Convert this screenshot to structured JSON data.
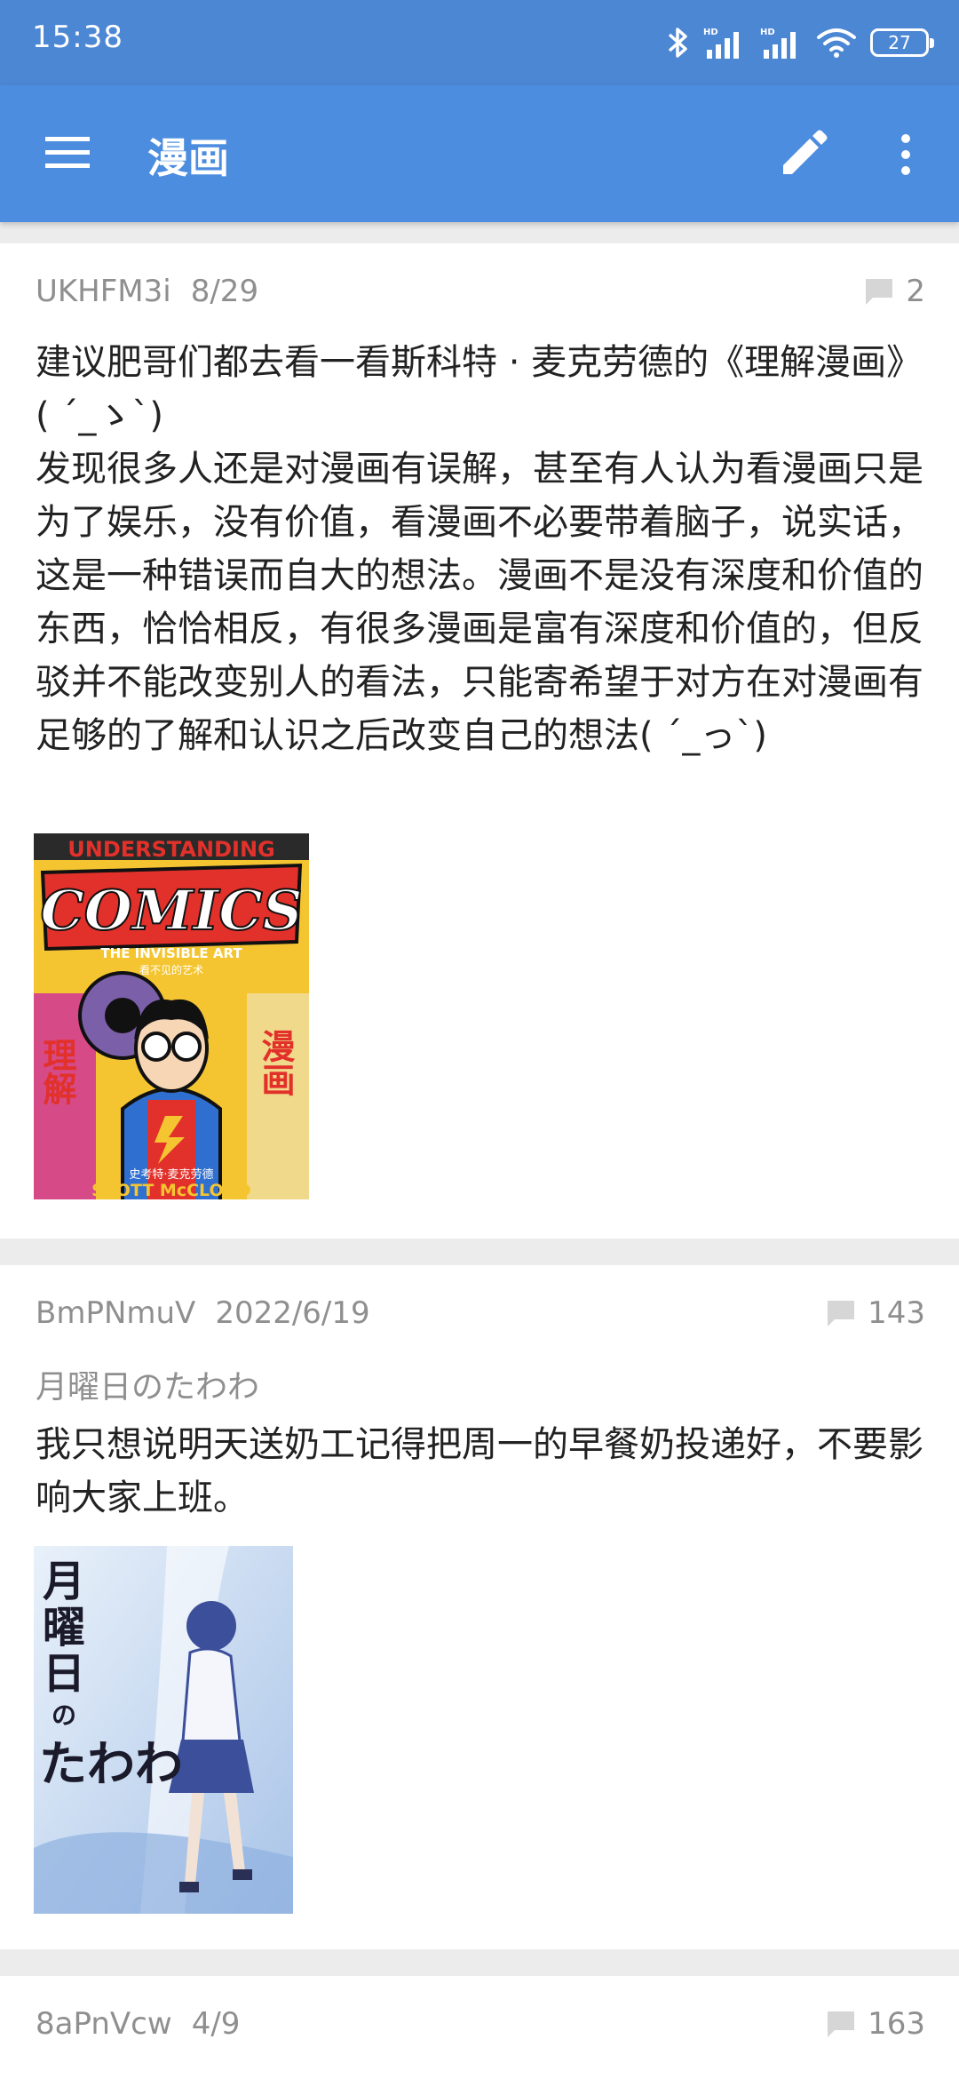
{
  "status": {
    "time": "15:38",
    "battery": "27",
    "icons": [
      "bluetooth-icon",
      "signal-hd-icon",
      "signal-hd-icon",
      "wifi-icon",
      "battery-icon"
    ]
  },
  "appbar": {
    "title": "漫画",
    "icons": [
      "menu-icon",
      "edit-icon",
      "more-vert-icon"
    ]
  },
  "posts": [
    {
      "user": "UKHFM3i",
      "date": "8/29",
      "replies": "2",
      "content": "建议肥哥们都去看一看斯科特 · 麦克劳德的《理解漫画》( ˊ_ゝˋ)\n发现很多人还是对漫画有误解，甚至有人认为看漫画只是为了娱乐，没有价值，看漫画不必要带着脑子，说实话，这是一种错误而自大的想法。漫画不是没有深度和价值的东西，恰恰相反，有很多漫画是富有深度和价值的，但反驳并不能改变别人的看法，只能寄希望于对方在对漫画有足够的了解和认识之后改变自己的想法( ˊ_っˋ)",
      "image": {
        "title_top": "UNDERSTANDING",
        "title_main": "COMICS",
        "tagline": "THE INVISIBLE ART",
        "tagline_cn": "看不见的艺术",
        "left_cn": "理解",
        "right_cn": "漫画",
        "author_cn": "史考特·麦克劳德",
        "author": "SCOTT McCLOUD"
      }
    },
    {
      "user": "BmPNmuV",
      "date": "2022/6/19",
      "replies": "143",
      "title": "月曜日のたわわ",
      "content": "我只想说明天送奶工记得把周一的早餐奶投递好，不要影响大家上班。",
      "image": {
        "line1": "月",
        "line2": "曜",
        "line3": "日",
        "line4": "の",
        "line5": "たわわ"
      }
    },
    {
      "user": "8aPnVcw",
      "date": "4/9",
      "replies": "163"
    }
  ],
  "colors": {
    "statusbar": "#4c87d4",
    "appbar": "#4d8ddf",
    "background": "#ececec",
    "meta_text": "#8f8f8f"
  }
}
